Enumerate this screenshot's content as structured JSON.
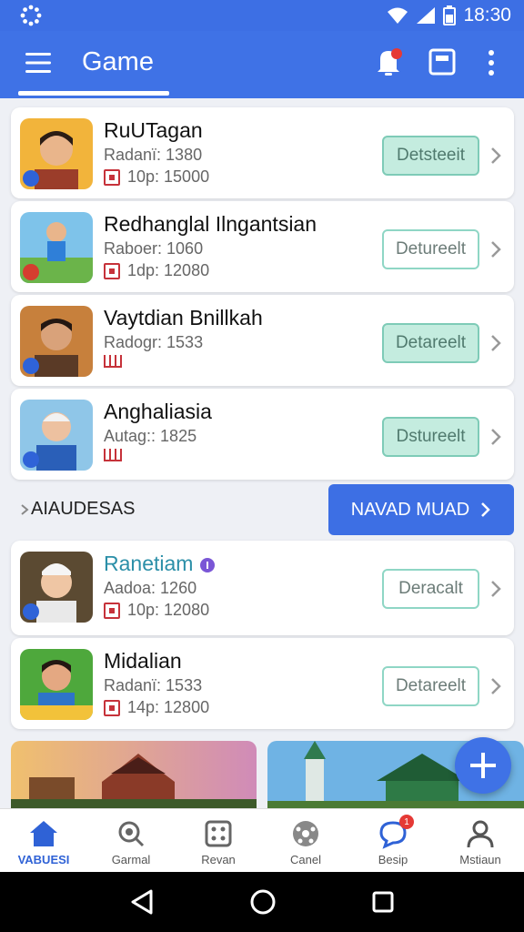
{
  "status_bar": {
    "time": "18:30"
  },
  "app_bar": {
    "title": "Game"
  },
  "games_top": [
    {
      "name": "RuUTagan",
      "rating": "Radanї: 1380",
      "players": "10p: 15000",
      "button": "Detsteeit",
      "button_style": "filled",
      "stat_icon": "square",
      "accent": false
    },
    {
      "name": "Redhanglal Ilngantsian",
      "rating": "Raboer: 1060",
      "players": "1dp: 12080",
      "button": "Detureelt",
      "button_style": "outline",
      "stat_icon": "square",
      "accent": false
    },
    {
      "name": "Vaytdian Bnillkah",
      "rating": "Radogr: 1533",
      "players": "",
      "button": "Detareelt",
      "button_style": "filled",
      "stat_icon": "bars",
      "accent": false
    },
    {
      "name": "Anghaliasia",
      "rating": "Autag:: 1825",
      "players": "",
      "button": "Dstureelt",
      "button_style": "filled",
      "stat_icon": "bars",
      "accent": false
    }
  ],
  "section": {
    "title": "AIAUDESAS",
    "button": "NAVAD MUAD"
  },
  "games_bottom": [
    {
      "name": "Ranetiam",
      "rating": "Aadoa: 1260",
      "players": "10p: 12080",
      "button": "Deracalt",
      "button_style": "outline",
      "stat_icon": "square",
      "accent": true
    },
    {
      "name": "Midalian",
      "rating": "Radanї: 1533",
      "players": "14p: 12800",
      "button": "Detareelt",
      "button_style": "outline",
      "stat_icon": "square",
      "accent": false
    }
  ],
  "bottom_nav": [
    {
      "label": "VABUESI",
      "icon": "home-icon",
      "active": true
    },
    {
      "label": "Garmal",
      "icon": "magnifier-icon",
      "active": false
    },
    {
      "label": "Revan",
      "icon": "dice-icon",
      "active": false
    },
    {
      "label": "Canel",
      "icon": "ball-icon",
      "active": false
    },
    {
      "label": "Besip",
      "icon": "chat-icon",
      "active": false,
      "badge": "1"
    },
    {
      "label": "Mstiaun",
      "icon": "profile-icon",
      "active": false
    }
  ],
  "colors": {
    "primary": "#3f72e6",
    "teal_button": "#c4ecdf",
    "accent_text": "#2b8fa8"
  }
}
